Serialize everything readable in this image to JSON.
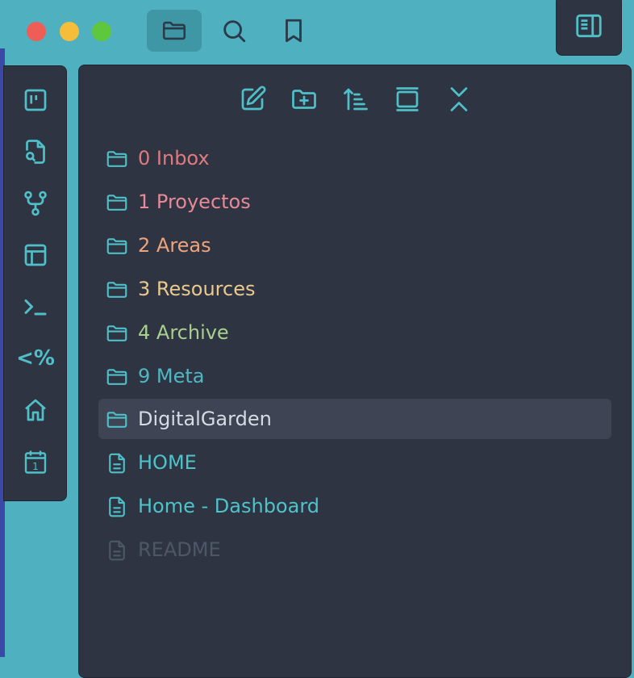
{
  "colors": {
    "desktop": "#4fb0c0",
    "panel": "#2f3443",
    "icon": "#4fc0c8",
    "selected_bg": "#3e4454"
  },
  "window_controls": [
    {
      "name": "close",
      "color": "#ee5e57"
    },
    {
      "name": "minimize",
      "color": "#f6bd3b"
    },
    {
      "name": "maximize",
      "color": "#5fc73e"
    }
  ],
  "top_tabs": [
    {
      "icon": "folder-icon",
      "active": true
    },
    {
      "icon": "search-icon",
      "active": false
    },
    {
      "icon": "bookmark-icon",
      "active": false
    }
  ],
  "right_toggle": {
    "icon": "sidebar-toggle-icon"
  },
  "ribbon": [
    {
      "icon": "kanban-icon"
    },
    {
      "icon": "file-search-icon"
    },
    {
      "icon": "git-branch-icon"
    },
    {
      "icon": "layout-icon"
    },
    {
      "icon": "terminal-icon"
    },
    {
      "icon": "templater-icon",
      "glyph": "<%"
    },
    {
      "icon": "home-icon"
    },
    {
      "icon": "calendar-icon",
      "glyph": "1"
    }
  ],
  "explorer_toolbar": [
    {
      "icon": "new-note-icon"
    },
    {
      "icon": "new-folder-icon"
    },
    {
      "icon": "sort-icon"
    },
    {
      "icon": "auto-reveal-icon"
    },
    {
      "icon": "collapse-all-icon"
    }
  ],
  "tree": [
    {
      "type": "folder",
      "label": "0 Inbox",
      "color": "#e07a7e"
    },
    {
      "type": "folder",
      "label": "1 Proyectos",
      "color": "#e58a96"
    },
    {
      "type": "folder",
      "label": "2 Areas",
      "color": "#eea47a"
    },
    {
      "type": "folder",
      "label": "3 Resources",
      "color": "#e9c98e"
    },
    {
      "type": "folder",
      "label": "4 Archive",
      "color": "#a9cf8e"
    },
    {
      "type": "folder",
      "label": "9 Meta",
      "color": "#4fb7c4"
    },
    {
      "type": "folder",
      "label": "DigitalGarden",
      "color": "#d6dbe4",
      "selected": true
    },
    {
      "type": "file",
      "label": "HOME",
      "color": "#4ec3c9"
    },
    {
      "type": "file",
      "label": "Home - Dashboard",
      "color": "#4ec3c9"
    },
    {
      "type": "file",
      "label": "README",
      "color": "#4c5866",
      "muted": true
    }
  ]
}
